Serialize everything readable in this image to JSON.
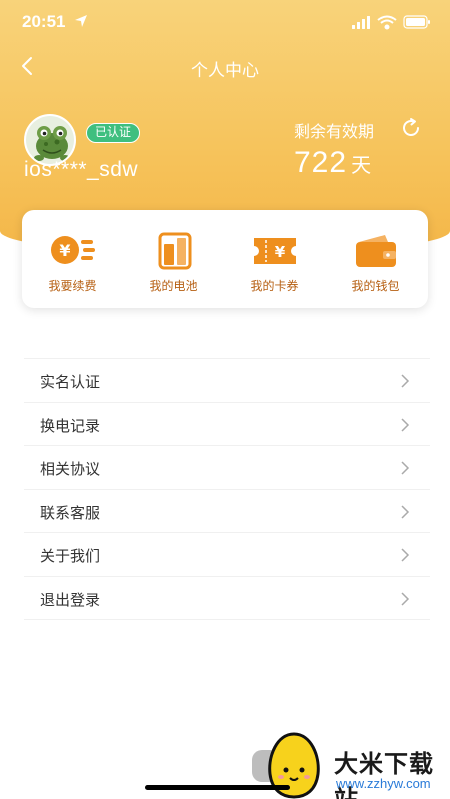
{
  "status_bar": {
    "time": "20:51"
  },
  "nav": {
    "title": "个人中心"
  },
  "profile": {
    "badge": "已认证",
    "username": "ios****_sdw"
  },
  "validity": {
    "label": "剩余有效期",
    "value": "722",
    "unit": "天"
  },
  "services": [
    {
      "label": "我要续费",
      "icon": "renew-icon"
    },
    {
      "label": "我的电池",
      "icon": "battery-icon"
    },
    {
      "label": "我的卡券",
      "icon": "coupon-icon"
    },
    {
      "label": "我的钱包",
      "icon": "wallet-icon"
    }
  ],
  "menu": [
    {
      "label": "实名认证"
    },
    {
      "label": "换电记录"
    },
    {
      "label": "相关协议"
    },
    {
      "label": "联系客服"
    },
    {
      "label": "关于我们"
    },
    {
      "label": "退出登录"
    }
  ],
  "watermark": {
    "title": "大米下载站",
    "url": "www.zzhyw.com"
  },
  "colors": {
    "header": "#f6c35b",
    "accent": "#ee8f1e",
    "badge": "#3fbf7f"
  }
}
